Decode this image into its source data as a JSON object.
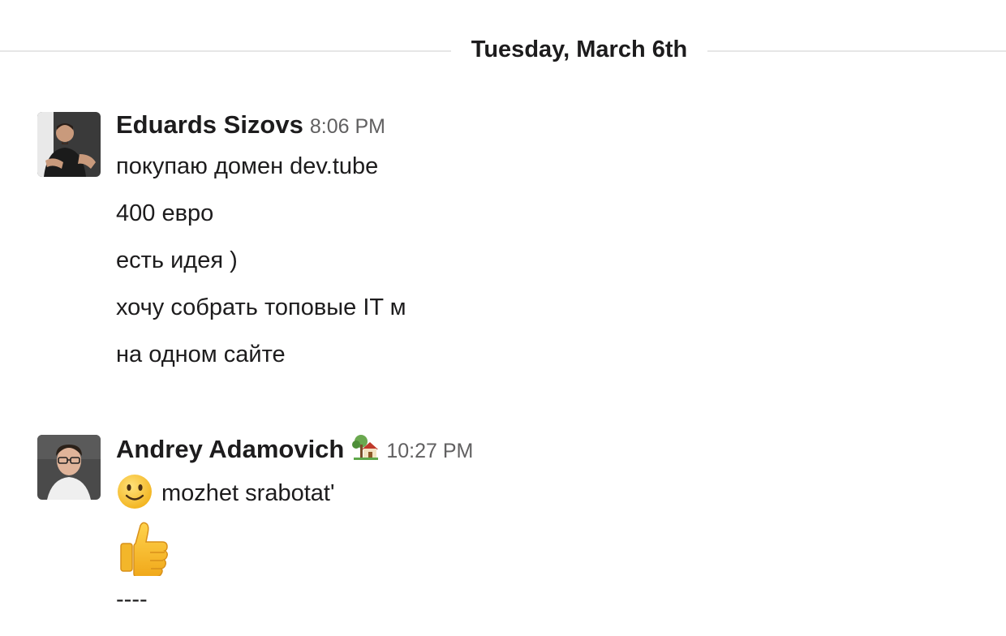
{
  "date_divider": {
    "label": "Tuesday, March 6th"
  },
  "messages": [
    {
      "sender": "Eduards Sizovs",
      "time": "8:06 PM",
      "avatar": "photo-avatar",
      "lines": [
        "покупаю домен dev.tube",
        "400 евро",
        "есть идея )",
        "хочу собрать топовые IT м",
        "на одном сайте"
      ]
    },
    {
      "sender": "Andrey Adamovich",
      "status_emoji": "house-with-garden-icon",
      "time": "10:27 PM",
      "avatar": "photo-avatar",
      "lines": [
        {
          "emoji": "slightly-smiling-face-icon",
          "text": "mozhet srabotat'"
        },
        {
          "emoji": "thumbs-up-icon",
          "text": ""
        },
        "----"
      ]
    }
  ],
  "colors": {
    "text": "#1d1c1d",
    "timestamp": "#616061",
    "divider": "#e6e6e6"
  }
}
